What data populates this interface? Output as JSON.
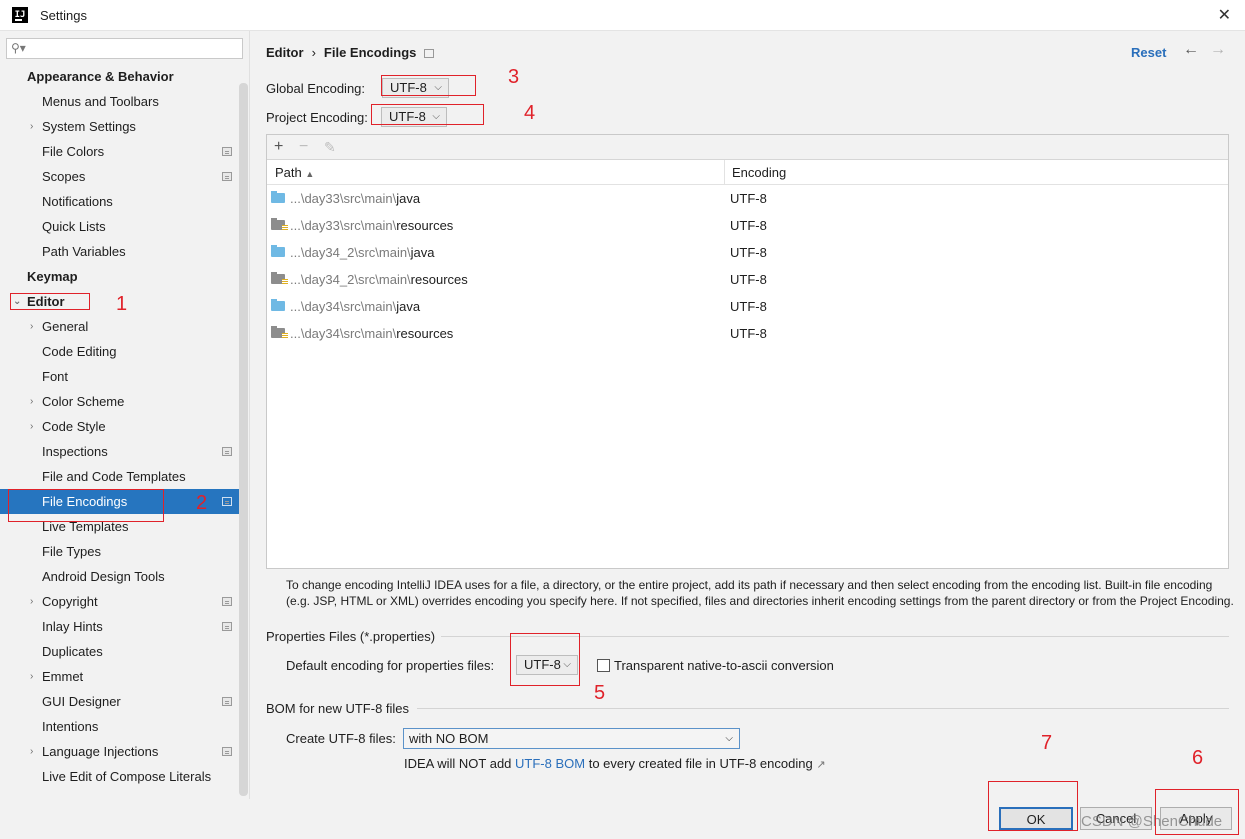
{
  "window": {
    "title": "Settings",
    "app_icon": "intellij-idea-icon"
  },
  "sidebar": {
    "search_placeholder": "",
    "items": [
      {
        "label": "Appearance & Behavior",
        "level": 0,
        "arrow": ""
      },
      {
        "label": "Menus and Toolbars",
        "level": 1
      },
      {
        "label": "System Settings",
        "level": 1,
        "arrow": "›"
      },
      {
        "label": "File Colors",
        "level": 1,
        "scope": true
      },
      {
        "label": "Scopes",
        "level": 1,
        "scope": true
      },
      {
        "label": "Notifications",
        "level": 1
      },
      {
        "label": "Quick Lists",
        "level": 1
      },
      {
        "label": "Path Variables",
        "level": 1
      },
      {
        "label": "Keymap",
        "level": 0
      },
      {
        "label": "Editor",
        "level": 0,
        "arrow": "⌄"
      },
      {
        "label": "General",
        "level": 1,
        "arrow": "›"
      },
      {
        "label": "Code Editing",
        "level": 1
      },
      {
        "label": "Font",
        "level": 1
      },
      {
        "label": "Color Scheme",
        "level": 1,
        "arrow": "›"
      },
      {
        "label": "Code Style",
        "level": 1,
        "arrow": "›"
      },
      {
        "label": "Inspections",
        "level": 1,
        "scope": true
      },
      {
        "label": "File and Code Templates",
        "level": 1
      },
      {
        "label": "File Encodings",
        "level": 1,
        "scope": true,
        "selected": true
      },
      {
        "label": "Live Templates",
        "level": 1
      },
      {
        "label": "File Types",
        "level": 1
      },
      {
        "label": "Android Design Tools",
        "level": 1
      },
      {
        "label": "Copyright",
        "level": 1,
        "arrow": "›",
        "scope": true
      },
      {
        "label": "Inlay Hints",
        "level": 1,
        "scope": true
      },
      {
        "label": "Duplicates",
        "level": 1
      },
      {
        "label": "Emmet",
        "level": 1,
        "arrow": "›"
      },
      {
        "label": "GUI Designer",
        "level": 1,
        "scope": true
      },
      {
        "label": "Intentions",
        "level": 1
      },
      {
        "label": "Language Injections",
        "level": 1,
        "arrow": "›",
        "scope": true
      },
      {
        "label": "Live Edit of Compose Literals",
        "level": 1
      }
    ]
  },
  "breadcrumb": {
    "parent": "Editor",
    "separator": "›",
    "current": "File Encodings"
  },
  "header": {
    "reset_label": "Reset",
    "back_icon": "←",
    "forward_icon": "→"
  },
  "encoding": {
    "global_label": "Global Encoding:",
    "global_value": "UTF-8",
    "project_label": "Project Encoding:",
    "project_value": "UTF-8"
  },
  "table": {
    "toolbar": {
      "add": "+",
      "remove": "−",
      "edit": "✎"
    },
    "columns": [
      "Path",
      "Encoding"
    ],
    "sort_indicator": "▲",
    "rows": [
      {
        "prefix": "...\\day33\\src\\main\\",
        "name": "java",
        "type": "source",
        "encoding": "UTF-8"
      },
      {
        "prefix": "...\\day33\\src\\main\\",
        "name": "resources",
        "type": "resources",
        "encoding": "UTF-8"
      },
      {
        "prefix": "...\\day34_2\\src\\main\\",
        "name": "java",
        "type": "source",
        "encoding": "UTF-8"
      },
      {
        "prefix": "...\\day34_2\\src\\main\\",
        "name": "resources",
        "type": "resources",
        "encoding": "UTF-8"
      },
      {
        "prefix": "...\\day34\\src\\main\\",
        "name": "java",
        "type": "source",
        "encoding": "UTF-8"
      },
      {
        "prefix": "...\\day34\\src\\main\\",
        "name": "resources",
        "type": "resources",
        "encoding": "UTF-8"
      }
    ]
  },
  "hint": {
    "line1": "To change encoding IntelliJ IDEA uses for a file, a directory, or the entire project, add its path if necessary and then select encoding from the encoding list. Built-in file encoding",
    "line2": "(e.g. JSP, HTML or XML) overrides encoding you specify here. If not specified, files and directories inherit encoding settings from the parent directory or from the Project Encoding."
  },
  "properties": {
    "section_title": "Properties Files (*.properties)",
    "default_label": "Default encoding for properties files:",
    "default_value": "UTF-8",
    "transparent_label": "Transparent native-to-ascii conversion",
    "transparent_checked": false
  },
  "bom": {
    "section_title": "BOM for new UTF-8 files",
    "create_label": "Create UTF-8 files:",
    "create_value": "with NO BOM",
    "note_before": "IDEA will NOT add ",
    "note_link": "UTF-8 BOM",
    "note_after": " to every created file in UTF-8 encoding",
    "note_arrow": "↗"
  },
  "buttons": {
    "ok": "OK",
    "cancel": "Cancel",
    "apply": "Apply",
    "help": "?"
  },
  "annotations": [
    "1",
    "2",
    "3",
    "4",
    "5",
    "6",
    "7"
  ],
  "watermark": "CSDN @ShenChude",
  "colors": {
    "selection": "#2675bf",
    "accent_link": "#2a6fbb",
    "annotation_red": "#e0222a"
  }
}
